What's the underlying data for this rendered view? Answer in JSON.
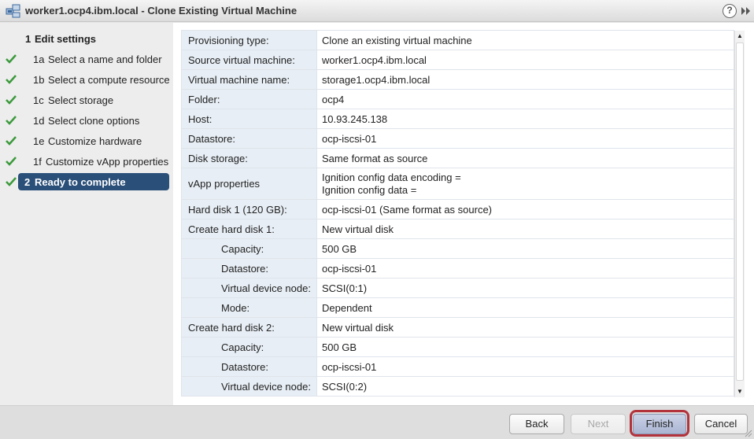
{
  "window": {
    "title": "worker1.ocp4.ibm.local - Clone Existing Virtual Machine",
    "help_label": "?"
  },
  "steps": [
    {
      "num": "1",
      "label": "Edit settings",
      "kind": "header",
      "done": false
    },
    {
      "num": "1a",
      "label": "Select a name and folder",
      "kind": "sub",
      "done": true
    },
    {
      "num": "1b",
      "label": "Select a compute resource",
      "kind": "sub",
      "done": true
    },
    {
      "num": "1c",
      "label": "Select storage",
      "kind": "sub",
      "done": true
    },
    {
      "num": "1d",
      "label": "Select clone options",
      "kind": "sub",
      "done": true
    },
    {
      "num": "1e",
      "label": "Customize hardware",
      "kind": "sub",
      "done": true
    },
    {
      "num": "1f",
      "label": "Customize vApp properties",
      "kind": "sub",
      "done": true
    },
    {
      "num": "2",
      "label": "Ready to complete",
      "kind": "header",
      "done": true,
      "active": true
    }
  ],
  "summary": {
    "rows": [
      {
        "key": "Provisioning type:",
        "value": "Clone an existing virtual machine"
      },
      {
        "key": "Source virtual machine:",
        "value": "worker1.ocp4.ibm.local"
      },
      {
        "key": "Virtual machine name:",
        "value": "storage1.ocp4.ibm.local"
      },
      {
        "key": "Folder:",
        "value": "ocp4"
      },
      {
        "key": "Host:",
        "value": "10.93.245.138"
      },
      {
        "key": "Datastore:",
        "value": "ocp-iscsi-01"
      },
      {
        "key": "Disk storage:",
        "value": "Same format as source"
      },
      {
        "key": "vApp properties",
        "value": "Ignition config data encoding =",
        "value2": "Ignition config data ="
      },
      {
        "key": "Hard disk 1 (120 GB):",
        "value": "ocp-iscsi-01 (Same format as source)"
      },
      {
        "key": "Create hard disk 1:",
        "value": "New virtual disk"
      },
      {
        "key": "Capacity:",
        "value": "500 GB",
        "indent": true
      },
      {
        "key": "Datastore:",
        "value": "ocp-iscsi-01",
        "indent": true
      },
      {
        "key": "Virtual device node:",
        "value": "SCSI(0:1)",
        "indent": true
      },
      {
        "key": "Mode:",
        "value": "Dependent",
        "indent": true
      },
      {
        "key": "Create hard disk 2:",
        "value": "New virtual disk"
      },
      {
        "key": "Capacity:",
        "value": "500 GB",
        "indent": true
      },
      {
        "key": "Datastore:",
        "value": "ocp-iscsi-01",
        "indent": true
      },
      {
        "key": "Virtual device node:",
        "value": "SCSI(0:2)",
        "indent": true
      }
    ]
  },
  "buttons": {
    "back": "Back",
    "next": "Next",
    "finish": "Finish",
    "cancel": "Cancel"
  },
  "icons": {
    "app": "vm-clone-icon",
    "help": "help-icon",
    "expand": "double-chevron-right-icon",
    "check": "checkmark-icon"
  },
  "colors": {
    "active_step": "#2a4f79",
    "check": "#3c9a3c",
    "key_cell": "#e7eef5",
    "finish_highlight": "#b3333d"
  }
}
